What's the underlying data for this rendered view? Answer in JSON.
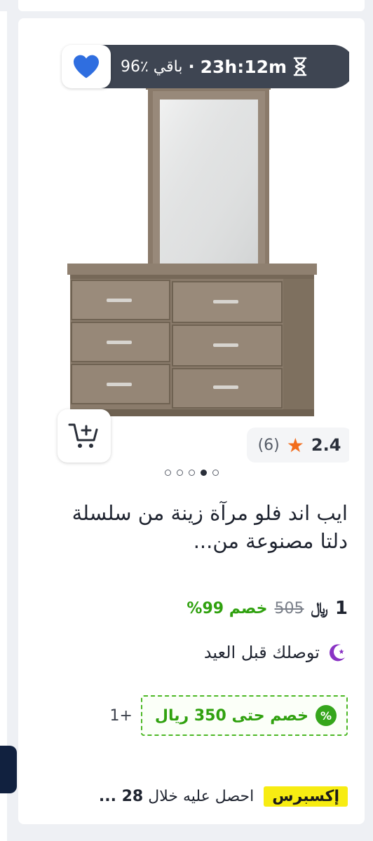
{
  "banner": {
    "timer": "23h:12m",
    "stock": "باقي ٪96",
    "separator": "·"
  },
  "product": {
    "title": "ايب اند فلو مرآة زينة من سلسلة دلتا مصنوعة من...",
    "rating": "2.4",
    "rating_count": "(6)",
    "image_dots_total": 5,
    "image_dots_active": 2
  },
  "price": {
    "current": "1",
    "currency_symbol": "﷼",
    "old": "505",
    "discount": "خصم 99%"
  },
  "delivery": {
    "text": "توصلك قبل العيد"
  },
  "coupon": {
    "badge": "%",
    "text": "خصم حتى 350 ريال",
    "more": "+1"
  },
  "express": {
    "badge": "إكسبرس",
    "text": "احصل عليه خلال",
    "days": "28 ..."
  },
  "colors": {
    "timer_bg": "#3e4552",
    "heart": "#2f6ee0",
    "discount_green": "#30a10f",
    "express_yellow": "#f7ec12",
    "rating_star": "#f26c1b",
    "moon_purple": "#8a33c4"
  },
  "icons": {
    "favorite": "heart-icon",
    "timer": "hourglass-icon",
    "cart": "add-to-cart-icon",
    "rating": "star-icon",
    "delivery": "crescent-moon-icon",
    "coupon": "percent-badge-icon"
  }
}
